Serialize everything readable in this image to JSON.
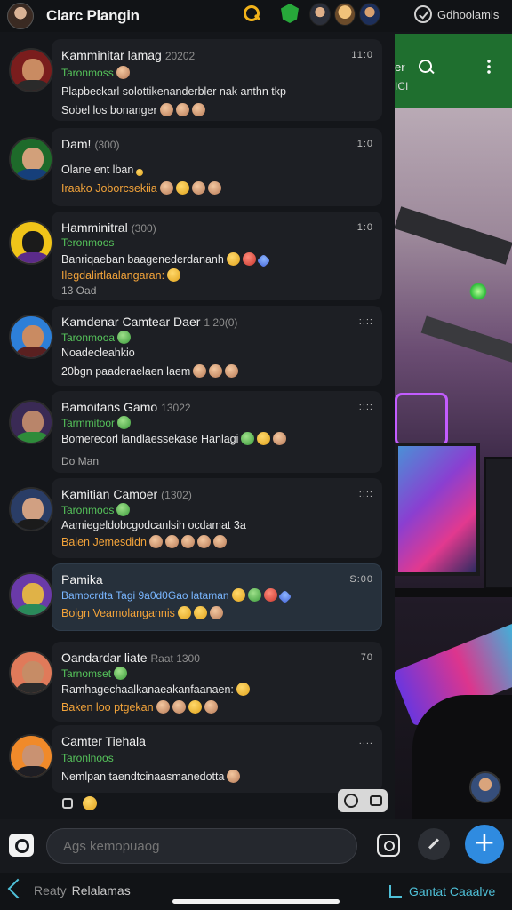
{
  "header": {
    "title": "Clarc Plangin",
    "right_text": "Gdhoolamls"
  },
  "chats": [
    {
      "name": "Kamminitar lamag",
      "tag": "20202",
      "time": "11:0",
      "subtitle": "Taronmoss",
      "line1": "Plapbeckarl solottikenanderbler nak anthn tkp",
      "line2": "Sobel los bonanger",
      "line2_color": "white",
      "line3": ""
    },
    {
      "name": "Dam!",
      "tag": "(300)",
      "time": "1:0",
      "subtitle": "",
      "line1": "Olane ent lban",
      "line2": "Iraako Joborcsekiia",
      "line2_color": "orange",
      "line3": ""
    },
    {
      "name": "Hamminitral",
      "tag": "(300)",
      "time": "1:0",
      "subtitle": "Teronmoos",
      "line1": "Banriqaeban baagenederdananh",
      "line2": "Ilegdalirtlaalangaran:",
      "line2_color": "orange",
      "line3": "13 Oad"
    },
    {
      "name": "Kamdenar Camtear Daer",
      "tag": "1 20(0)",
      "time": "::::",
      "subtitle": "Taronmooa",
      "line1": "Noadecleahkio",
      "line2": "20bgn paaderaelaen laem",
      "line2_color": "white",
      "line3": ""
    },
    {
      "name": "Bamoitans Gamo",
      "tag": "13022",
      "time": "::::",
      "subtitle": "Tarmmitoor",
      "line1": "Bomerecorl landlaessekase Hanlagi",
      "line2": "",
      "line2_color": "white",
      "line3": "Do Man"
    },
    {
      "name": "Kamitian Camoer",
      "tag": "(1302)",
      "time": "::::",
      "subtitle": "Taronmoos",
      "line1": "Aamiegeldobcgodcanlsih ocdamat 3a",
      "line2": "Baien Jemesdidn",
      "line2_color": "orange",
      "line3": ""
    },
    {
      "name": "Pamika",
      "tag": "",
      "time": "S:00",
      "subtitle": "Bamocrdta Tagi 9a0d0Gao lataman",
      "subtitle_color": "blue",
      "line1": "",
      "line2": "Boign Veamolangannis",
      "line2_color": "orange",
      "line3": "",
      "active": true
    },
    {
      "name": "Oandardar liate",
      "tag": "Raat 1300",
      "time": "70",
      "subtitle": "Tarnomset",
      "line1": "Ramhagechaalkanaeakanfaanaen:",
      "line2": "Baken loo ptgekan",
      "line2_color": "orange",
      "line3": ""
    },
    {
      "name": "Camter Tiehala",
      "tag": "",
      "time": "....",
      "subtitle": "Taronlnoos",
      "line1": "Nemlpan taendtcinaasmanedotta",
      "line2": "",
      "line2_color": "white",
      "line3": ""
    }
  ],
  "right_pane": {
    "header_line1": "er",
    "header_line2": "ICI"
  },
  "composer": {
    "placeholder": "Ags kemopuaog"
  },
  "bottom_nav": {
    "left_label_a": "Reaty",
    "left_label_b": "Relalamas",
    "right_label": "Gantat Caaalve"
  },
  "colors": {
    "accent_green": "#56c45b",
    "accent_orange": "#f2a33a",
    "accent_blue": "#2f8be0",
    "header_green": "#1f6f2f"
  }
}
